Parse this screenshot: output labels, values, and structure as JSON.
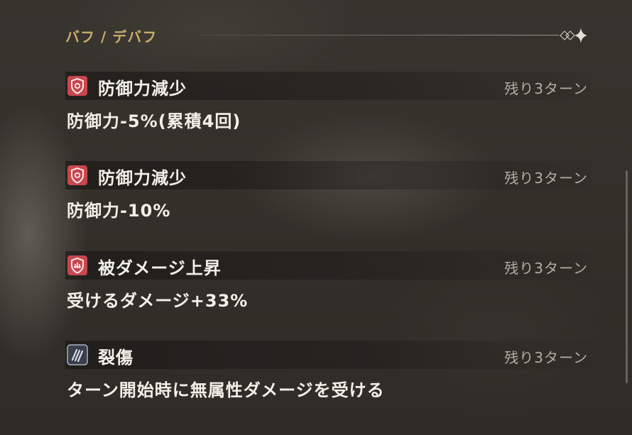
{
  "section": {
    "title": "バフ / デバフ"
  },
  "effects": [
    {
      "icon": "shield-debuff-icon",
      "name": "防御力減少",
      "turns": "残り3ターン",
      "description": "防御力-5%(累積4回)"
    },
    {
      "icon": "shield-debuff-icon",
      "name": "防御力減少",
      "turns": "残り3ターン",
      "description": "防御力-10%"
    },
    {
      "icon": "damage-taken-up-icon",
      "name": "被ダメージ上昇",
      "turns": "残り3ターン",
      "description": "受けるダメージ+33%"
    },
    {
      "icon": "laceration-icon",
      "name": "裂傷",
      "turns": "残り3ターン",
      "description": "ターン開始時に無属性ダメージを受ける"
    }
  ],
  "colors": {
    "section_title": "#c9aa6a",
    "debuff_icon_bg": "#c8464e",
    "laceration_icon_bg": "#8e9aae",
    "text_primary": "#f4f0e8",
    "text_secondary": "#b5ada0"
  }
}
